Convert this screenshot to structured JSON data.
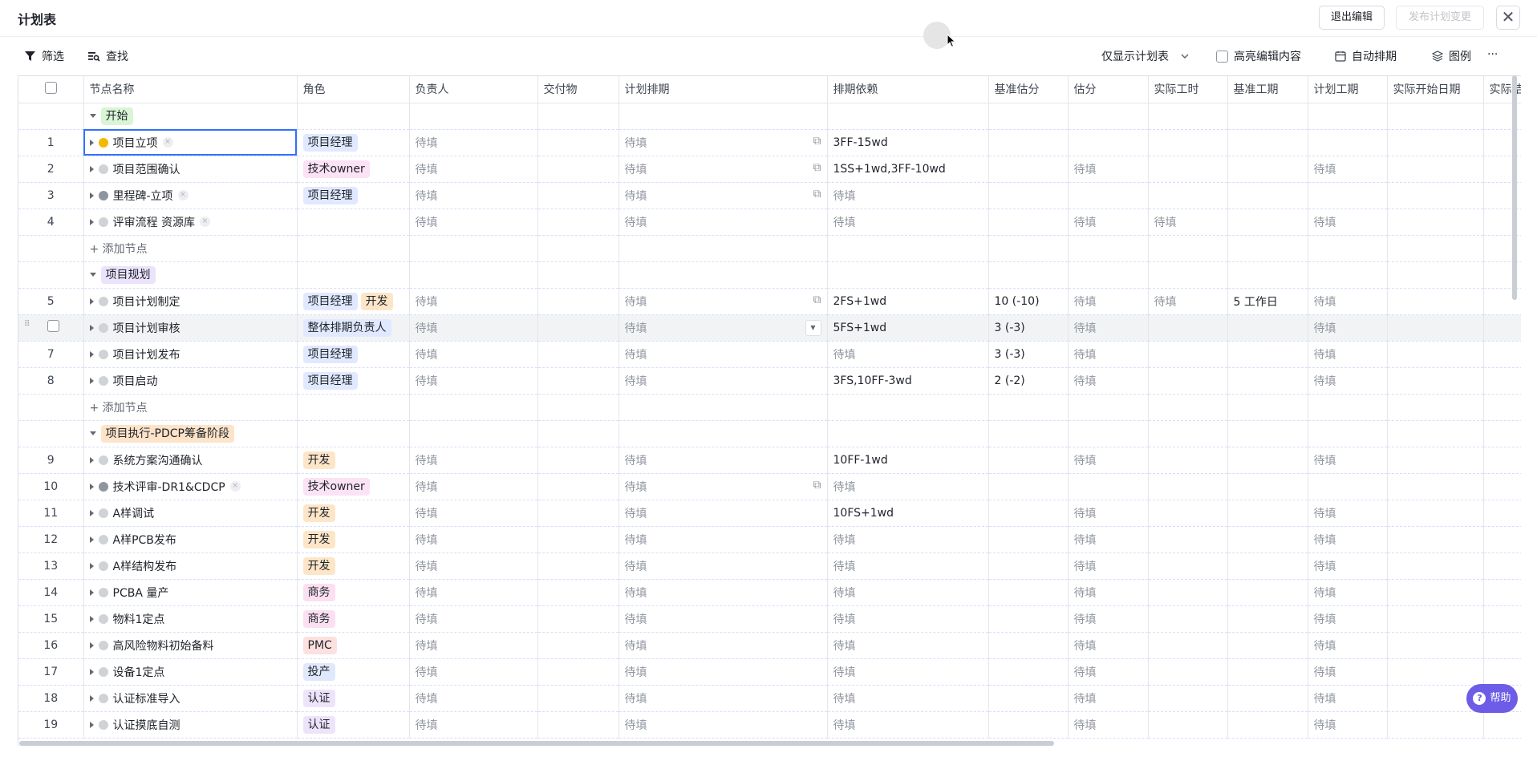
{
  "header": {
    "title": "计划表",
    "exit_edit": "退出编辑",
    "publish": "发布计划变更",
    "close": "✕"
  },
  "toolbar": {
    "filter": "筛选",
    "search": "查找",
    "view_mode": "仅显示计划表",
    "highlight": "高亮编辑内容",
    "auto_schedule": "自动排期",
    "legend": "图例",
    "more": "···"
  },
  "columns": [
    "节点名称",
    "角色",
    "负责人",
    "交付物",
    "计划排期",
    "排期依赖",
    "基准估分",
    "估分",
    "实际工时",
    "基准工期",
    "计划工期",
    "实际开始日期",
    "实际结"
  ],
  "placeholder": "待填",
  "add_node": "+ 添加节点",
  "groups": [
    {
      "name": "开始",
      "rows": [
        {
          "num": "1",
          "name": "项目立项",
          "roles": [
            "项目经理"
          ],
          "dep": "3FF-15wd",
          "base": "",
          "est": "",
          "actual": "",
          "base_dur": "",
          "plan_dur": ""
        },
        {
          "num": "2",
          "name": "项目范围确认",
          "roles": [
            "技术owner"
          ],
          "dep": "1SS+1wd,3FF-10wd",
          "base": "",
          "est": "待填",
          "actual": "",
          "base_dur": "",
          "plan_dur": "待填"
        },
        {
          "num": "3",
          "name": "里程碑-立项",
          "roles": [
            "项目经理"
          ],
          "dep": "待填",
          "base": "",
          "est": "",
          "actual": "",
          "base_dur": "",
          "plan_dur": ""
        },
        {
          "num": "4",
          "name": "评审流程 资源库",
          "roles": [],
          "dep": "待填",
          "base": "",
          "est": "待填",
          "actual": "待填",
          "base_dur": "",
          "plan_dur": "待填"
        }
      ]
    },
    {
      "name": "项目规划",
      "rows": [
        {
          "num": "5",
          "name": "项目计划制定",
          "roles": [
            "项目经理",
            "开发"
          ],
          "dep": "2FS+1wd",
          "base": "10 (-10)",
          "est": "待填",
          "actual": "待填",
          "base_dur": "5 工作日",
          "plan_dur": "待填"
        },
        {
          "num": "",
          "name": "项目计划审核",
          "roles": [
            "整体排期负责人"
          ],
          "dep": "5FS+1wd",
          "base": "3 (-3)",
          "est": "待填",
          "actual": "",
          "base_dur": "",
          "plan_dur": "待填"
        },
        {
          "num": "7",
          "name": "项目计划发布",
          "roles": [
            "项目经理"
          ],
          "dep": "待填",
          "base": "3 (-3)",
          "est": "待填",
          "actual": "",
          "base_dur": "",
          "plan_dur": "待填"
        },
        {
          "num": "8",
          "name": "项目启动",
          "roles": [
            "项目经理"
          ],
          "dep": "3FS,10FF-3wd",
          "base": "2 (-2)",
          "est": "待填",
          "actual": "",
          "base_dur": "",
          "plan_dur": "待填"
        }
      ]
    },
    {
      "name": "项目执行-PDCP筹备阶段",
      "rows": [
        {
          "num": "9",
          "name": "系统方案沟通确认",
          "roles": [
            "开发"
          ],
          "dep": "10FF-1wd",
          "est": "待填",
          "plan_dur": "待填"
        },
        {
          "num": "10",
          "name": "技术评审-DR1&CDCP",
          "roles": [
            "技术owner"
          ],
          "dep": "待填",
          "est": "",
          "plan_dur": ""
        },
        {
          "num": "11",
          "name": "A样调试",
          "roles": [
            "开发"
          ],
          "dep": "10FS+1wd",
          "est": "待填",
          "plan_dur": "待填"
        },
        {
          "num": "12",
          "name": "A样PCB发布",
          "roles": [
            "开发"
          ],
          "dep": "待填",
          "est": "待填",
          "plan_dur": "待填"
        },
        {
          "num": "13",
          "name": "A样结构发布",
          "roles": [
            "开发"
          ],
          "dep": "待填",
          "est": "待填",
          "plan_dur": "待填"
        },
        {
          "num": "14",
          "name": "PCBA 量产",
          "roles": [
            "商务"
          ],
          "dep": "待填",
          "est": "待填",
          "plan_dur": "待填"
        },
        {
          "num": "15",
          "name": "物料1定点",
          "roles": [
            "商务"
          ],
          "dep": "待填",
          "est": "待填",
          "plan_dur": "待填"
        },
        {
          "num": "16",
          "name": "高风险物料初始备料",
          "roles": [
            "PMC"
          ],
          "dep": "待填",
          "est": "待填",
          "plan_dur": "待填"
        },
        {
          "num": "17",
          "name": "设备1定点",
          "roles": [
            "投产"
          ],
          "dep": "待填",
          "est": "待填",
          "plan_dur": "待填"
        },
        {
          "num": "18",
          "name": "认证标准导入",
          "roles": [
            "认证"
          ],
          "dep": "待填",
          "est": "待填",
          "plan_dur": "待填"
        },
        {
          "num": "19",
          "name": "认证摸底自测",
          "roles": [
            "认证"
          ],
          "dep": "待填",
          "est": "待填",
          "plan_dur": "待填"
        }
      ]
    }
  ],
  "help": "帮助"
}
